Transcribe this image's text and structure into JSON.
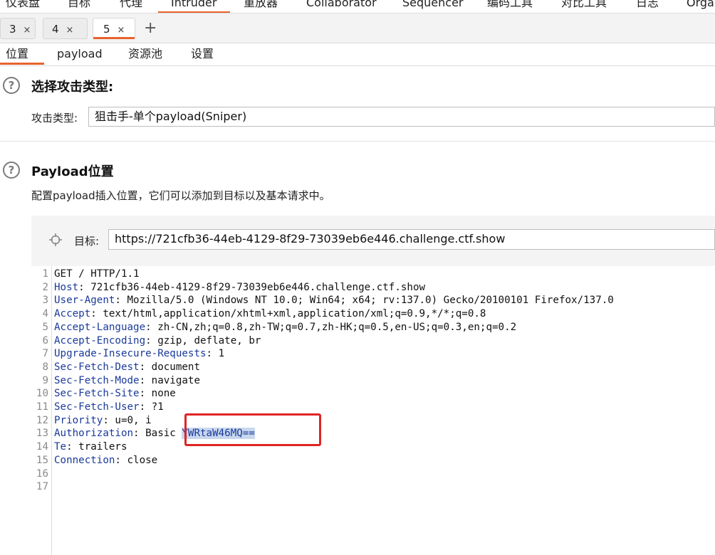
{
  "menu": {
    "items": [
      "仪表盘",
      "目标",
      "代理",
      "Intruder",
      "重放器",
      "Collaborator",
      "Sequencer",
      "编码工具",
      "对比工具",
      "日志",
      "Orga"
    ],
    "active_index": 3
  },
  "tabs": {
    "items": [
      {
        "label": "3",
        "close": "×"
      },
      {
        "label": "4",
        "close": "×"
      },
      {
        "label": "5",
        "close": "×"
      }
    ],
    "active_index": 2,
    "add": "+"
  },
  "subtabs": [
    "位置",
    "payload",
    "资源池",
    "设置"
  ],
  "attack_type": {
    "heading": "选择攻击类型:",
    "label": "攻击类型:",
    "value": "狙击手-单个payload(Sniper)"
  },
  "positions": {
    "heading": "Payload位置",
    "description": "配置payload插入位置，它们可以添加到目标以及基本请求中。",
    "target_label": "目标:",
    "target_value": "https://721cfb36-44eb-4129-8f29-73039eb6e446.challenge.ctf.show"
  },
  "request": {
    "lines": [
      {
        "n": "1",
        "key": "",
        "rest": "GET / HTTP/1.1"
      },
      {
        "n": "2",
        "key": "Host",
        "rest": ": 721cfb36-44eb-4129-8f29-73039eb6e446.challenge.ctf.show"
      },
      {
        "n": "3",
        "key": "User-Agent",
        "rest": ": Mozilla/5.0 (Windows NT 10.0; Win64; x64; rv:137.0) Gecko/20100101 Firefox/137.0"
      },
      {
        "n": "4",
        "key": "Accept",
        "rest": ": text/html,application/xhtml+xml,application/xml;q=0.9,*/*;q=0.8"
      },
      {
        "n": "5",
        "key": "Accept-Language",
        "rest": ": zh-CN,zh;q=0.8,zh-TW;q=0.7,zh-HK;q=0.5,en-US;q=0.3,en;q=0.2"
      },
      {
        "n": "6",
        "key": "Accept-Encoding",
        "rest": ": gzip, deflate, br"
      },
      {
        "n": "7",
        "key": "Upgrade-Insecure-Requests",
        "rest": ": 1"
      },
      {
        "n": "8",
        "key": "Sec-Fetch-Dest",
        "rest": ": document"
      },
      {
        "n": "9",
        "key": "Sec-Fetch-Mode",
        "rest": ": navigate"
      },
      {
        "n": "10",
        "key": "Sec-Fetch-Site",
        "rest": ": none"
      },
      {
        "n": "11",
        "key": "Sec-Fetch-User",
        "rest": ": ?1"
      },
      {
        "n": "12",
        "key": "Priority",
        "rest": ": u=0, i"
      },
      {
        "n": "13",
        "key": "Authorization",
        "rest": ": Basic ",
        "selected": "YWRtaW46MQ=="
      },
      {
        "n": "14",
        "key": "Te",
        "rest": ": trailers"
      },
      {
        "n": "15",
        "key": "Connection",
        "rest": ": close"
      },
      {
        "n": "16",
        "key": "",
        "rest": ""
      },
      {
        "n": "17",
        "key": "",
        "rest": ""
      }
    ]
  },
  "colors": {
    "accent": "#e8622c",
    "header_key": "#1a3a9a",
    "highlight": "#e02424"
  },
  "icons": {
    "help": "question-circle-icon",
    "target": "crosshair-icon"
  }
}
